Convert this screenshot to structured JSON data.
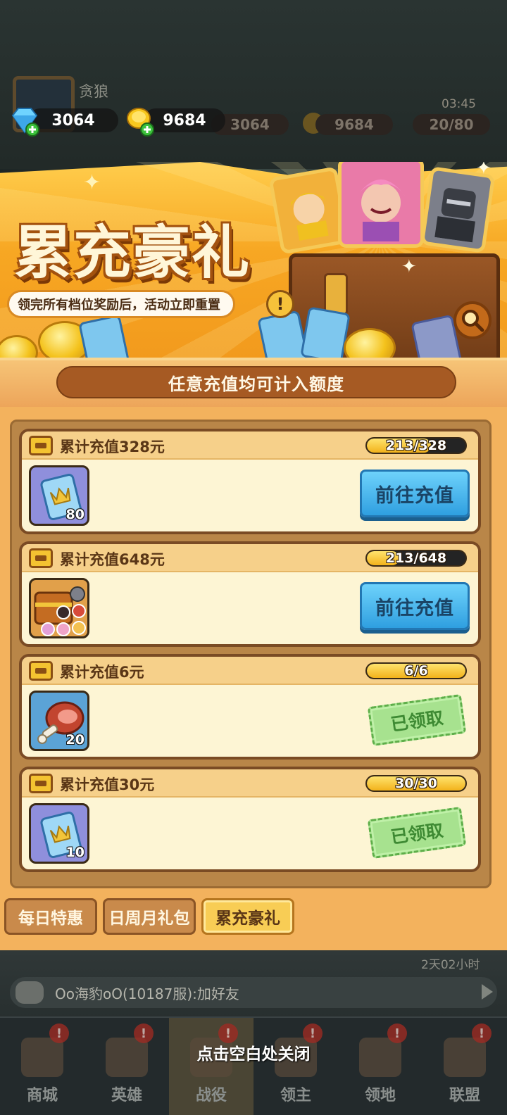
{
  "background": {
    "player_name": "贪狼",
    "ghost_gems": "3064",
    "ghost_coins": "9684",
    "ghost_stamina": "20/80",
    "ghost_time": "03:45"
  },
  "hud": {
    "gems": "3064",
    "coins": "9684"
  },
  "banner": {
    "title": "累充豪礼",
    "subtitle": "领完所有档位奖励后，活动立即重置",
    "info_glyph": "!"
  },
  "panel": {
    "notice": "任意充值均可计入额度"
  },
  "tiers": [
    {
      "title": "累计充值328元",
      "progress_text": "213/328",
      "progress_fraction": 0.649,
      "reward_qty": "80",
      "reward_icon": "blue-ticket",
      "action": "前往充值",
      "claimed": false
    },
    {
      "title": "累计充值648元",
      "progress_text": "213/648",
      "progress_fraction": 0.329,
      "reward_qty": "",
      "reward_icon": "hero-chest",
      "action": "前往充值",
      "claimed": false
    },
    {
      "title": "累计充值6元",
      "progress_text": "6/6",
      "progress_fraction": 1.0,
      "reward_qty": "20",
      "reward_icon": "meat",
      "action": "已领取",
      "claimed": true
    },
    {
      "title": "累计充值30元",
      "progress_text": "30/30",
      "progress_fraction": 1.0,
      "reward_qty": "10",
      "reward_icon": "blue-ticket",
      "action": "已领取",
      "claimed": true
    }
  ],
  "tabs": [
    {
      "label": "每日特惠",
      "active": false
    },
    {
      "label": "日周月礼包",
      "active": false
    },
    {
      "label": "累充豪礼",
      "active": true
    }
  ],
  "bottom": {
    "timer": "2天02小时",
    "chat_message": "Oo海豹oO(10187服):加好友",
    "close_hint": "点击空白处关闭",
    "nav": [
      "商城",
      "英雄",
      "战役",
      "领主",
      "领地",
      "联盟"
    ],
    "nav_badge": "!"
  },
  "colors": {
    "banner_gold": "#f7a723",
    "panel_orange": "#f3b25d",
    "go_button_blue": "#2f9fe0",
    "claimed_green": "#a7e28f"
  }
}
